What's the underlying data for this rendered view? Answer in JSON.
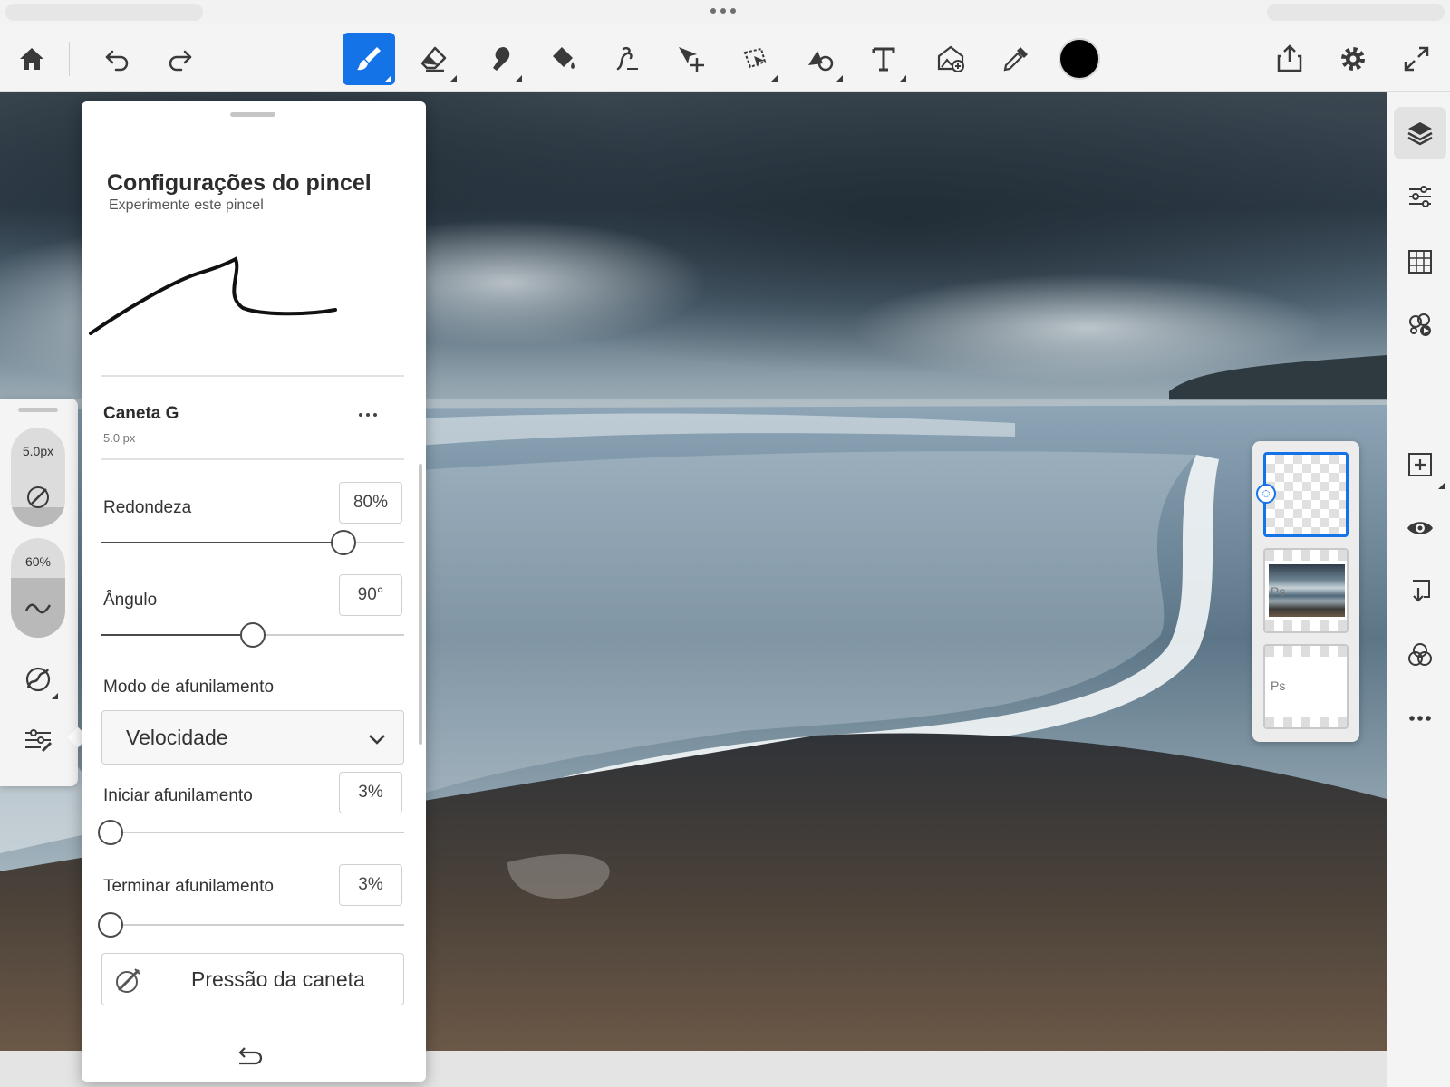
{
  "toolbar": {
    "tools": [
      {
        "id": "home",
        "icon": "home-icon"
      },
      {
        "id": "undo",
        "icon": "undo-icon"
      },
      {
        "id": "redo",
        "icon": "redo-icon"
      },
      {
        "id": "brush",
        "icon": "brush-icon",
        "active": true
      },
      {
        "id": "eraser",
        "icon": "eraser-icon"
      },
      {
        "id": "smudge",
        "icon": "smudge-icon"
      },
      {
        "id": "fill",
        "icon": "paint-bucket-icon"
      },
      {
        "id": "liquify",
        "icon": "liquify-icon"
      },
      {
        "id": "transform",
        "icon": "move-transform-icon"
      },
      {
        "id": "lasso",
        "icon": "lasso-icon"
      },
      {
        "id": "shapes",
        "icon": "shapes-icon"
      },
      {
        "id": "text",
        "icon": "text-icon"
      },
      {
        "id": "place-image",
        "icon": "place-image-icon"
      },
      {
        "id": "eyedropper",
        "icon": "eyedropper-icon"
      }
    ],
    "color": "#000000",
    "right_tools": [
      {
        "id": "share",
        "icon": "share-icon"
      },
      {
        "id": "settings",
        "icon": "gear-icon"
      },
      {
        "id": "fullscreen",
        "icon": "fullscreen-icon"
      }
    ],
    "accent_color": "#1473e6"
  },
  "left_toolbar": {
    "size_value": "5.0px",
    "size_level": 0.2,
    "flow_value": "60%",
    "flow_level": 0.6
  },
  "brush_panel": {
    "title": "Configurações do pincel",
    "subtitle": "Experimente este pincel",
    "brush_name": "Caneta G",
    "brush_size": "5.0 px",
    "roundness": {
      "label": "Redondeza",
      "value": "80%",
      "percent": 80
    },
    "angle": {
      "label": "Ângulo",
      "value": "90°",
      "percent": 50
    },
    "taper_mode": {
      "label": "Modo de afunilamento",
      "selected": "Velocidade"
    },
    "start_taper": {
      "label": "Iniciar afunilamento",
      "value": "3%",
      "percent": 3
    },
    "end_taper": {
      "label": "Terminar afunilamento",
      "value": "3%",
      "percent": 3
    },
    "pen_pressure": {
      "label": "Pressão da caneta"
    }
  },
  "layers": {
    "items": [
      {
        "name": "transparent-layer",
        "selected": true,
        "badge": ""
      },
      {
        "name": "photo-layer",
        "selected": false,
        "badge": "Ps"
      },
      {
        "name": "white-layer",
        "selected": false,
        "badge": "Ps"
      }
    ]
  },
  "right_panel": {
    "tools": [
      {
        "id": "layers",
        "icon": "layers-icon",
        "active": true
      },
      {
        "id": "layer-properties",
        "icon": "sliders-icon"
      },
      {
        "id": "grid",
        "icon": "grid-icon"
      },
      {
        "id": "actions",
        "icon": "actions-icon"
      },
      {
        "id": "add-layer",
        "icon": "add-layer-icon"
      },
      {
        "id": "visibility",
        "icon": "eye-icon"
      },
      {
        "id": "merge-down",
        "icon": "merge-down-icon"
      },
      {
        "id": "blend-mode",
        "icon": "blend-mode-icon"
      },
      {
        "id": "more",
        "icon": "more-icon"
      }
    ]
  }
}
